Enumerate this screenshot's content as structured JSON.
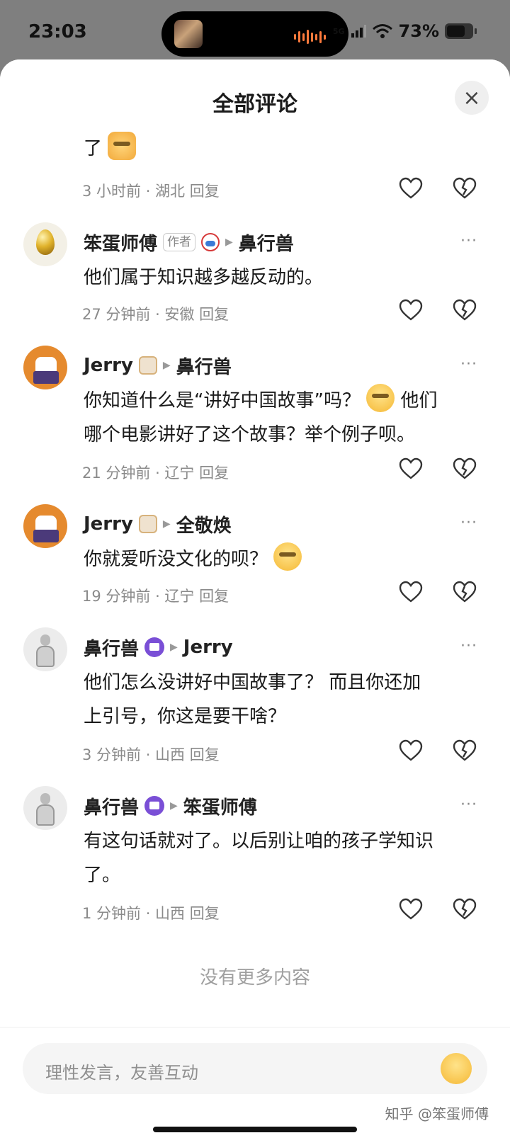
{
  "status_bar": {
    "time": "23:03",
    "network": "5G",
    "battery": "73%",
    "battery_level": 0.73
  },
  "sheet": {
    "title": "全部评论",
    "close_label": "×"
  },
  "comments": [
    {
      "username": "",
      "meta": "3 小时前 · 湖北 回复",
      "text_partial": "了"
    },
    {
      "username": "笨蛋师傅",
      "author_tag": "作者",
      "reply_to": "鼻行兽",
      "text": "他们属于知识越多越反动的。",
      "meta": "27 分钟前 · 安徽 回复"
    },
    {
      "username": "Jerry",
      "reply_to": "鼻行兽",
      "text_a": "你知道什么是“讲好中国故事”吗？",
      "text_b": "他们",
      "text_c": "哪个电影讲好了这个故事？举个例子呗。",
      "meta": "21 分钟前 · 辽宁 回复"
    },
    {
      "username": "Jerry",
      "reply_to": "全敬焕",
      "text": "你就爱听没文化的呗？",
      "meta": "19 分钟前 · 辽宁 回复"
    },
    {
      "username": "鼻行兽",
      "reply_to": "Jerry",
      "text_a": "他们怎么没讲好中国故事了？ 而且你还加",
      "text_b": "上引号，你这是要干啥？",
      "meta": "3 分钟前 · 山西 回复"
    },
    {
      "username": "鼻行兽",
      "reply_to": "笨蛋师傅",
      "text_a": "有这句话就对了。以后别让咱的孩子学知识",
      "text_b": "了。",
      "meta": "1 分钟前 · 山西 回复"
    }
  ],
  "more_label": "···",
  "no_more": "没有更多内容",
  "input": {
    "placeholder": "理性发言，友善互动"
  },
  "watermark": "知乎 @笨蛋师傅",
  "icons": {
    "like": "heart-icon",
    "dislike": "broken-heart-icon",
    "emoji": "emoji-icon",
    "close": "close-icon"
  }
}
